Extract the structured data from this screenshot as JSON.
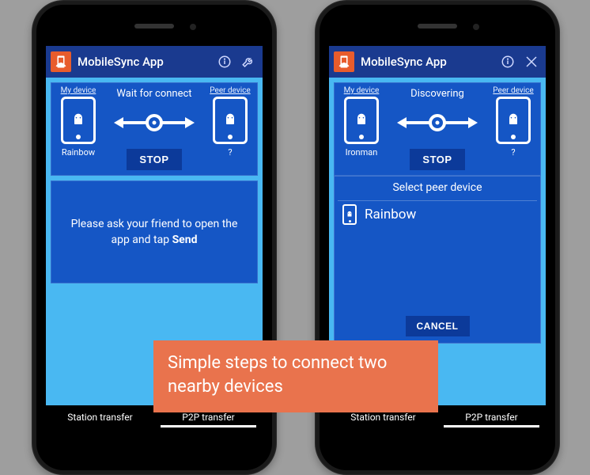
{
  "app_title": "MobileSync App",
  "labels": {
    "my_device": "My device",
    "peer_device": "Peer device",
    "stop": "STOP",
    "cancel": "CANCEL",
    "select_peer": "Select peer device"
  },
  "tabs": {
    "station": "Station transfer",
    "p2p": "P2P transfer"
  },
  "left": {
    "status": "Wait for connect",
    "my_name": "Rainbow",
    "peer_name": "?",
    "msg_pre": "Please ask your friend to open the app and tap ",
    "msg_bold": "Send"
  },
  "right": {
    "status": "Discovering",
    "my_name": "Ironman",
    "peer_name": "?",
    "peer_list": [
      "Rainbow"
    ]
  },
  "banner": "Simple steps to connect two nearby devices"
}
